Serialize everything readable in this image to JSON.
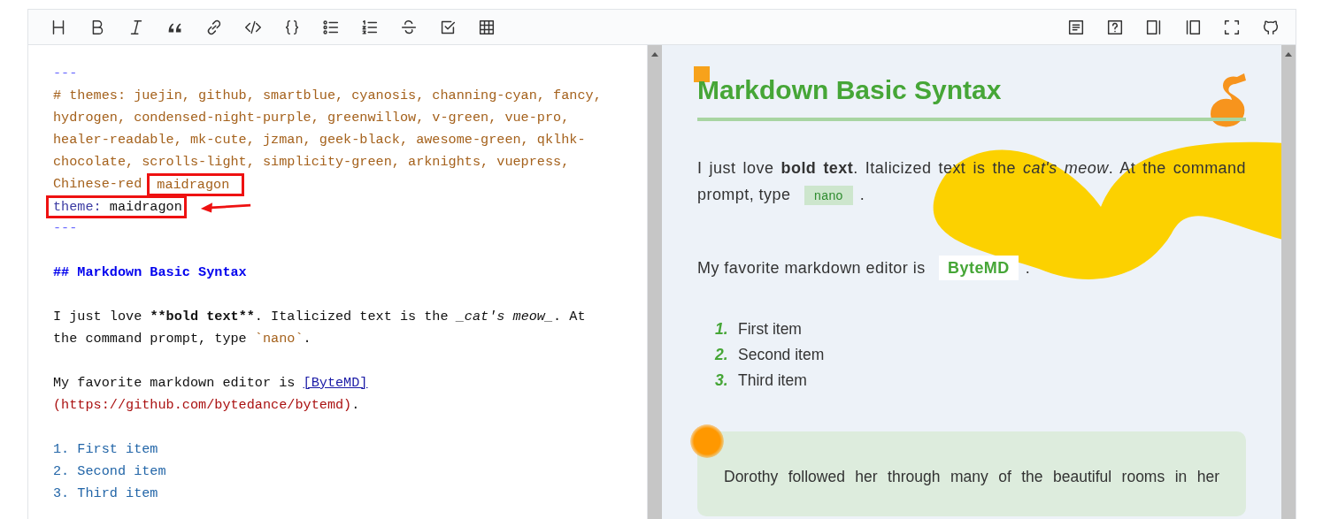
{
  "editor": {
    "lines": [
      {
        "kind": "code",
        "segments": [
          {
            "kind": "hr",
            "text": "---"
          }
        ]
      },
      {
        "kind": "code",
        "segments": [
          {
            "kind": "comment",
            "text": "# themes: juejin, github, smartblue, cyanosis, channing-cyan, fancy,"
          }
        ]
      },
      {
        "kind": "code",
        "segments": [
          {
            "kind": "comment",
            "text": "hydrogen, condensed-night-purple, greenwillow, v-green, vue-pro,"
          }
        ]
      },
      {
        "kind": "code",
        "segments": [
          {
            "kind": "comment",
            "text": "healer-readable, mk-cute, jzman, geek-black, awesome-green, qklhk-"
          }
        ]
      },
      {
        "kind": "code",
        "segments": [
          {
            "kind": "comment",
            "text": "chocolate, scrolls-light, simplicity-green, arknights, vuepress,"
          }
        ]
      },
      {
        "kind": "code",
        "segments": [
          {
            "kind": "comment",
            "text": "Chinese-red"
          },
          {
            "kind": "comment",
            "text": "maidragon",
            "boxed": true
          }
        ]
      },
      {
        "kind": "code",
        "boxed": true,
        "arrow": true,
        "segments": [
          {
            "kind": "key",
            "text": "theme:"
          },
          {
            "kind": "plain",
            "text": " maidragon"
          }
        ]
      },
      {
        "kind": "code",
        "segments": [
          {
            "kind": "hr",
            "text": "---"
          }
        ]
      },
      {
        "kind": "blank"
      },
      {
        "kind": "code",
        "segments": [
          {
            "kind": "heading",
            "text": "## Markdown Basic Syntax"
          }
        ]
      },
      {
        "kind": "blank"
      },
      {
        "kind": "code",
        "segments": [
          {
            "kind": "plain",
            "text": "I just love "
          },
          {
            "kind": "strong",
            "text": "**bold text**"
          },
          {
            "kind": "plain",
            "text": ". Italicized text is the "
          },
          {
            "kind": "em",
            "text": "_cat's meow_"
          },
          {
            "kind": "plain",
            "text": ". At"
          }
        ]
      },
      {
        "kind": "code",
        "segments": [
          {
            "kind": "plain",
            "text": "the command prompt, type "
          },
          {
            "kind": "code",
            "text": "`nano`"
          },
          {
            "kind": "plain",
            "text": "."
          }
        ]
      },
      {
        "kind": "blank"
      },
      {
        "kind": "code",
        "segments": [
          {
            "kind": "plain",
            "text": "My favorite markdown editor is "
          },
          {
            "kind": "link",
            "text": "[ByteMD]"
          }
        ]
      },
      {
        "kind": "code",
        "segments": [
          {
            "kind": "url",
            "text": "(https://github.com/bytedance/bytemd)"
          },
          {
            "kind": "plain",
            "text": "."
          }
        ]
      },
      {
        "kind": "blank"
      },
      {
        "kind": "code",
        "segments": [
          {
            "kind": "list",
            "text": "1. First item"
          }
        ]
      },
      {
        "kind": "code",
        "segments": [
          {
            "kind": "list",
            "text": "2. Second item"
          }
        ]
      },
      {
        "kind": "code",
        "segments": [
          {
            "kind": "list",
            "text": "3. Third item"
          }
        ]
      }
    ]
  },
  "preview": {
    "title": "Markdown Basic Syntax",
    "blocks": [
      {
        "kind": "paragraph",
        "parts": [
          {
            "kind": "text",
            "text": "I just love **bold text**. Italicized text is the *cat's meow*. At the command prompt, type "
          },
          {
            "kind": "code",
            "text": "nano"
          },
          {
            "kind": "text",
            "text": "."
          }
        ]
      },
      {
        "kind": "paragraph",
        "parts": [
          {
            "kind": "text",
            "text": "My favorite markdown editor is "
          },
          {
            "kind": "link",
            "text": "ByteMD"
          },
          {
            "kind": "text",
            "text": "."
          }
        ]
      },
      {
        "kind": "list",
        "items": [
          {
            "marker": "1.",
            "text": "First item"
          },
          {
            "marker": "2.",
            "text": "Second item"
          },
          {
            "marker": "3.",
            "text": "Third item"
          }
        ]
      },
      {
        "kind": "quote",
        "text": "Dorothy followed her through many of the beautiful rooms in her"
      }
    ]
  }
}
